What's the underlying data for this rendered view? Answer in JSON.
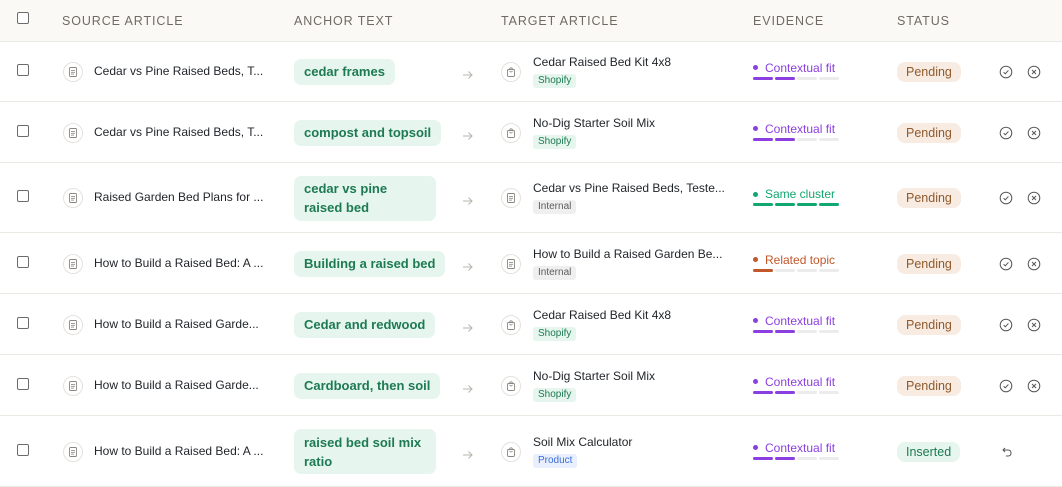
{
  "header": {
    "source": "SOURCE ARTICLE",
    "anchor": "ANCHOR TEXT",
    "target": "TARGET ARTICLE",
    "evidence": "EVIDENCE",
    "status": "STATUS"
  },
  "colors": {
    "contextual": "#8b3fe0",
    "cluster": "#12a670",
    "related": "#c2572a"
  },
  "rows": [
    {
      "source": "Cedar vs Pine Raised Beds, T...",
      "anchor": "cedar frames",
      "target": "Cedar Raised Bed Kit 4x8",
      "tag": "Shopify",
      "evidence": "Contextual fit",
      "strength": 2,
      "status": "Pending"
    },
    {
      "source": "Cedar vs Pine Raised Beds, T...",
      "anchor": "compost and topsoil",
      "target": "No-Dig Starter Soil Mix",
      "tag": "Shopify",
      "evidence": "Contextual fit",
      "strength": 2,
      "status": "Pending"
    },
    {
      "source": "Raised Garden Bed Plans for ...",
      "anchor": "cedar vs pine raised bed",
      "target": "Cedar vs Pine Raised Beds, Teste...",
      "tag": "Internal",
      "evidence": "Same cluster",
      "strength": 4,
      "status": "Pending"
    },
    {
      "source": "How to Build a Raised Bed: A ...",
      "anchor": "Building a raised bed",
      "target": "How to Build a Raised Garden Be...",
      "tag": "Internal",
      "evidence": "Related topic",
      "strength": 1,
      "status": "Pending"
    },
    {
      "source": "How to Build a Raised Garde...",
      "anchor": "Cedar and redwood",
      "target": "Cedar Raised Bed Kit 4x8",
      "tag": "Shopify",
      "evidence": "Contextual fit",
      "strength": 2,
      "status": "Pending"
    },
    {
      "source": "How to Build a Raised Garde...",
      "anchor": "Cardboard, then soil",
      "target": "No-Dig Starter Soil Mix",
      "tag": "Shopify",
      "evidence": "Contextual fit",
      "strength": 2,
      "status": "Pending"
    },
    {
      "source": "How to Build a Raised Bed: A ...",
      "anchor": "raised bed soil mix ratio",
      "target": "Soil Mix Calculator",
      "tag": "Product",
      "evidence": "Contextual fit",
      "strength": 2,
      "status": "Inserted"
    }
  ]
}
